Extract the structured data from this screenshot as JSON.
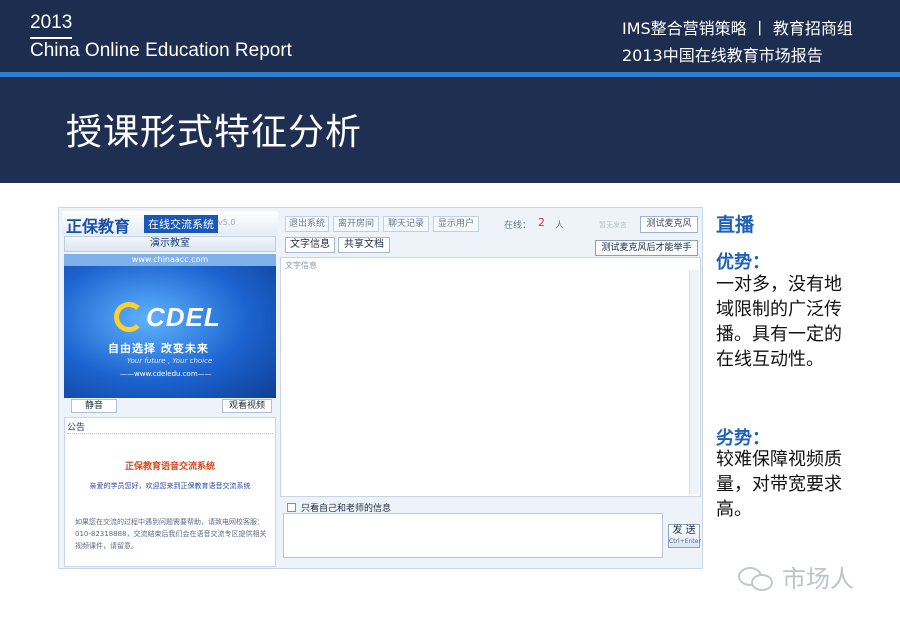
{
  "header": {
    "year": "2013",
    "report_title": "China Online Education Report",
    "right_line1": "IMS整合营销策略 丨 教育招商组",
    "right_line2": "2013中国在线教育市场报告"
  },
  "slide_title": "授课形式特征分析",
  "app": {
    "brand_name": "正保教育",
    "brand_sub": "在线交流系统",
    "brand_ver": "v5.0",
    "toolbar": [
      "退出系统",
      "离开房间",
      "聊天记录",
      "显示用户"
    ],
    "online_label": "在线：",
    "online_count": "2",
    "online_unit": "人",
    "faint_label": "暂无发言",
    "mic_test": "测试麦克风",
    "tabs": [
      "文字信息",
      "共享文档"
    ],
    "mic_hint": "测试麦克风后才能举手",
    "demo_label": "演示教室",
    "video": {
      "url_top": "www.chinaacc.com",
      "logo": "CDEL",
      "slogan": "自由选择  改变未来",
      "slogan_en": "Your future , Your choice",
      "url_bottom": "——www.cdeledu.com——"
    },
    "mute_btn": "静音",
    "watch_btn": "观看视频",
    "notice": {
      "head": "公告",
      "title": "正保教育语音交流系统",
      "welcome": "亲爱的学员您好，欢迎您来到正保教育语音交流系统",
      "body": "如果您在交流的过程中遇到问题需要帮助，请致电网校客服：010-82318888，交流结束后我们会在语音交流专区提供相关视频课件，请留意。"
    },
    "text_area_head": "文字信息",
    "only_mine": "只看自己和老师的信息",
    "send_label": "发 送",
    "send_hint": "Ctrl+Enter"
  },
  "right_column": {
    "live_heading": "直播",
    "pros_heading": "优势：",
    "pros_text": "一对多，没有地域限制的广泛传播。具有一定的在线互动性。",
    "cons_heading": "劣势：",
    "cons_text": "较难保障视频质量，对带宽要求高。"
  },
  "watermark": "市场人",
  "colors": {
    "header_bg": "#1c2d4f",
    "accent_rule": "#2f7fd1",
    "heading_blue": "#1f61b7",
    "online_red": "#e0302b"
  },
  "icons": {
    "watermark": "wechat-icon",
    "cdel_logo": "cdel-swirl-logo"
  }
}
